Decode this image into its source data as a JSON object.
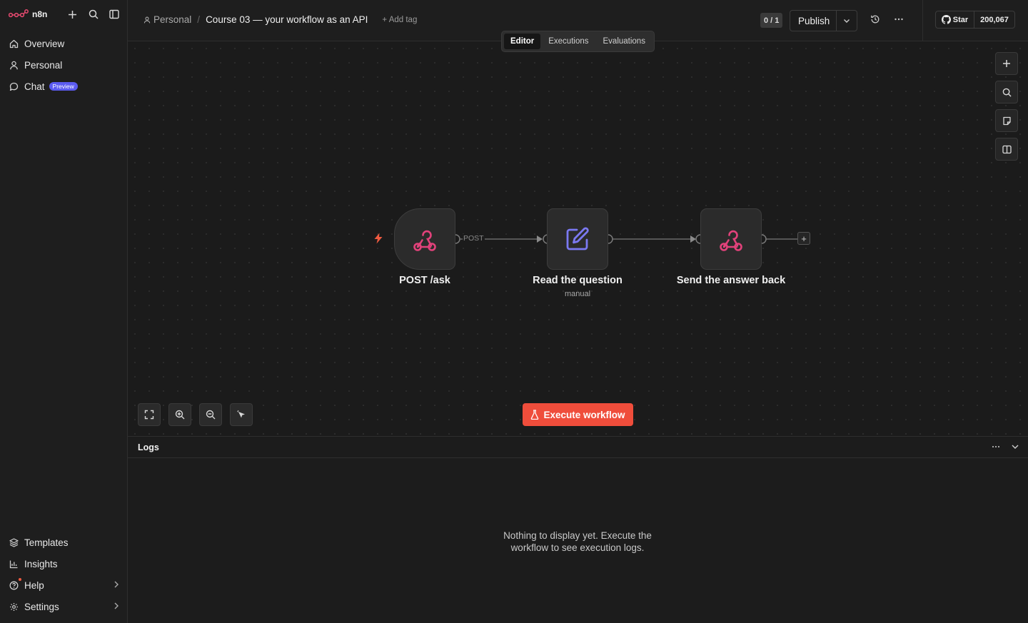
{
  "app": {
    "logo_text": "n8n"
  },
  "sidebar": {
    "top_icons": [
      "plus-icon",
      "search-icon",
      "panel-toggle-icon"
    ],
    "nav": [
      {
        "label": "Overview",
        "icon": "home-icon"
      },
      {
        "label": "Personal",
        "icon": "user-icon"
      },
      {
        "label": "Chat",
        "icon": "chat-icon",
        "badge": "Preview"
      }
    ],
    "bottom": [
      {
        "label": "Templates",
        "icon": "templates-icon"
      },
      {
        "label": "Insights",
        "icon": "insights-icon"
      },
      {
        "label": "Help",
        "icon": "help-icon",
        "has_chevron": true,
        "notification_dot": true
      },
      {
        "label": "Settings",
        "icon": "gear-icon",
        "has_chevron": true
      }
    ]
  },
  "header": {
    "breadcrumb": {
      "project": "Personal",
      "separator": "/",
      "workflow_name": "Course 03 — your workflow as an API",
      "add_tag": "+ Add tag"
    },
    "version_badge": "0 / 1",
    "publish_label": "Publish",
    "github": {
      "star_label": "Star",
      "count": "200,067"
    },
    "tabs": [
      {
        "label": "Editor",
        "active": true
      },
      {
        "label": "Executions",
        "active": false
      },
      {
        "label": "Evaluations",
        "active": false
      }
    ]
  },
  "canvas": {
    "nodes": [
      {
        "label": "POST /ask",
        "sublabel": "",
        "icon": "webhook-icon",
        "trigger": true
      },
      {
        "label": "Read the question",
        "sublabel": "manual",
        "icon": "edit-icon",
        "trigger": false
      },
      {
        "label": "Send the answer back",
        "sublabel": "",
        "icon": "webhook-icon",
        "trigger": false
      }
    ],
    "edge_label": "POST",
    "execute_label": "Execute workflow",
    "right_tools": [
      "plus-icon",
      "search-icon",
      "sticky-note-icon",
      "panel-icon"
    ],
    "bottom_tools": [
      "fit-view-icon",
      "zoom-in-icon",
      "zoom-out-icon",
      "tidy-up-icon"
    ]
  },
  "logs": {
    "title": "Logs",
    "empty_message": "Nothing to display yet. Execute the workflow to see execution logs."
  },
  "colors": {
    "accent": "#ef4d3b",
    "webhook_icon": "#e2427b",
    "edit_icon": "#7b79f2",
    "badge": "#5b5bf0"
  }
}
